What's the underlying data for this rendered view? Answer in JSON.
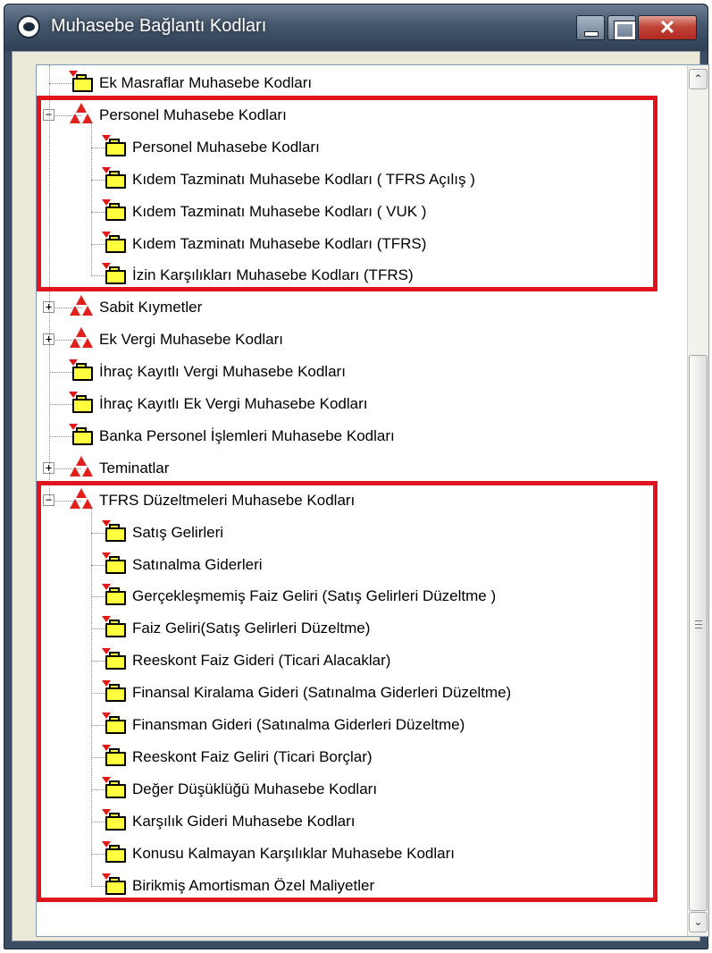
{
  "window": {
    "title": "Muhasebe Bağlantı Kodları",
    "close_glyph": "✕"
  },
  "scrollbar": {
    "up_glyph": "⌃",
    "down_glyph": "⌄"
  },
  "tree": {
    "rows": [
      {
        "label": "Ek Masraflar Muhasebe Kodları",
        "icon": "folder-icon",
        "level": 1
      },
      {
        "label": "Personel Muhasebe Kodları",
        "icon": "group-icon",
        "level": 1,
        "expander": "−"
      },
      {
        "label": "Personel Muhasebe Kodları",
        "icon": "folder-icon",
        "level": 2
      },
      {
        "label": "Kıdem Tazminatı Muhasebe Kodları ( TFRS Açılış )",
        "icon": "folder-icon",
        "level": 2
      },
      {
        "label": "Kıdem Tazminatı Muhasebe Kodları ( VUK )",
        "icon": "folder-icon",
        "level": 2
      },
      {
        "label": "Kıdem Tazminatı Muhasebe Kodları (TFRS)",
        "icon": "folder-icon",
        "level": 2
      },
      {
        "label": "İzin Karşılıkları Muhasebe Kodları (TFRS)",
        "icon": "folder-icon",
        "level": 2
      },
      {
        "label": "Sabit Kıymetler",
        "icon": "group-icon",
        "level": 1,
        "expander": "+"
      },
      {
        "label": "Ek Vergi Muhasebe Kodları",
        "icon": "group-icon",
        "level": 1,
        "expander": "+"
      },
      {
        "label": "İhraç Kayıtlı Vergi Muhasebe Kodları",
        "icon": "folder-icon",
        "level": 1
      },
      {
        "label": "İhraç Kayıtlı Ek Vergi Muhasebe Kodları",
        "icon": "folder-icon",
        "level": 1
      },
      {
        "label": "Banka Personel İşlemleri Muhasebe Kodları",
        "icon": "folder-icon",
        "level": 1
      },
      {
        "label": "Teminatlar",
        "icon": "group-icon",
        "level": 1,
        "expander": "+"
      },
      {
        "label": "TFRS Düzeltmeleri Muhasebe Kodları",
        "icon": "group-icon",
        "level": 1,
        "expander": "−"
      },
      {
        "label": "Satış Gelirleri",
        "icon": "folder-icon",
        "level": 2
      },
      {
        "label": "Satınalma Giderleri",
        "icon": "folder-icon",
        "level": 2
      },
      {
        "label": "Gerçekleşmemiş Faiz Geliri (Satış Gelirleri Düzeltme )",
        "icon": "folder-icon",
        "level": 2
      },
      {
        "label": "Faiz Geliri(Satış Gelirleri Düzeltme)",
        "icon": "folder-icon",
        "level": 2
      },
      {
        "label": "Reeskont Faiz Gideri (Ticari Alacaklar)",
        "icon": "folder-icon",
        "level": 2
      },
      {
        "label": "Finansal Kiralama Gideri (Satınalma Giderleri Düzeltme)",
        "icon": "folder-icon",
        "level": 2
      },
      {
        "label": "Finansman Gideri (Satınalma Giderleri Düzeltme)",
        "icon": "folder-icon",
        "level": 2
      },
      {
        "label": "Reeskont Faiz Geliri (Ticari Borçlar)",
        "icon": "folder-icon",
        "level": 2
      },
      {
        "label": "Değer Düşüklüğü Muhasebe Kodları",
        "icon": "folder-icon",
        "level": 2
      },
      {
        "label": "Karşılık Gideri Muhasebe Kodları",
        "icon": "folder-icon",
        "level": 2
      },
      {
        "label": "Konusu Kalmayan Karşılıklar Muhasebe Kodları",
        "icon": "folder-icon",
        "level": 2
      },
      {
        "label": "Birikmiş Amortisman Özel Maliyetler",
        "icon": "folder-icon",
        "level": 2
      }
    ]
  },
  "colors": {
    "highlight_border": "#e0141e",
    "folder_fill": "#ffff3f",
    "group_icon": "#e0201c",
    "title_text": "#ffffff"
  }
}
